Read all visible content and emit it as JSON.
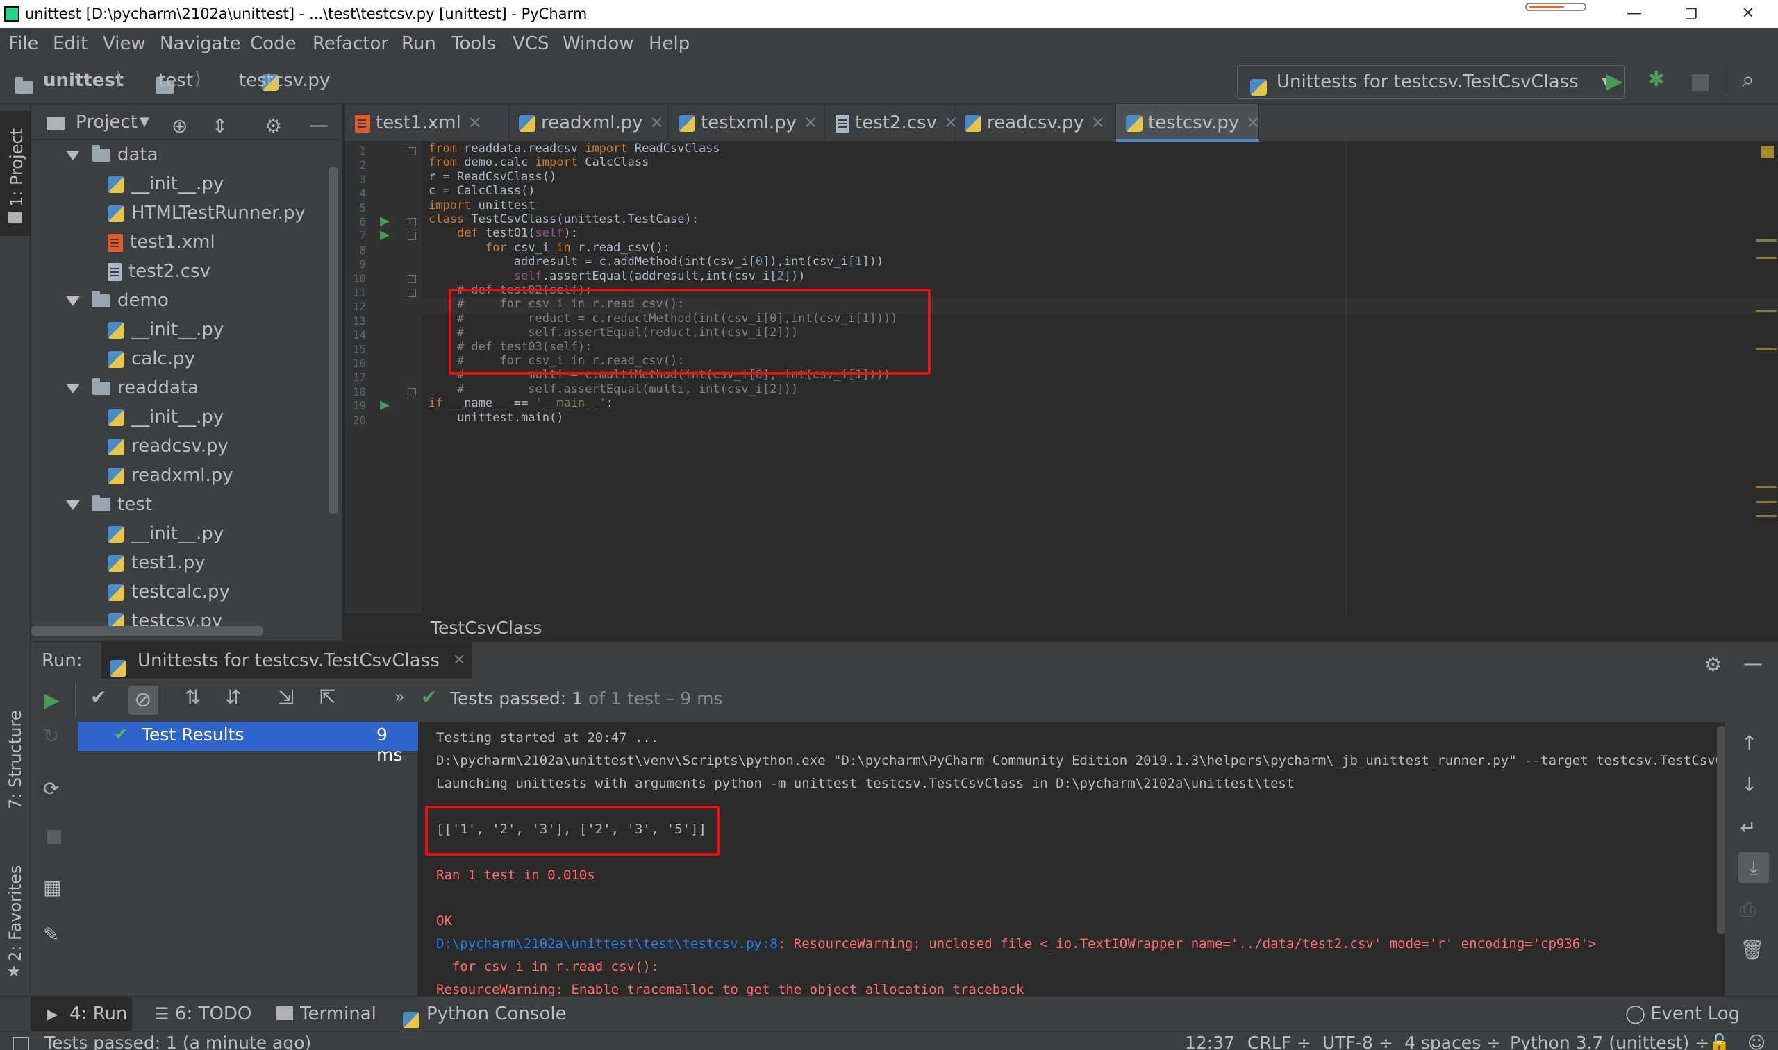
{
  "window": {
    "title": "unittest [D:\\pycharm\\2102a\\unittest] - ...\\test\\testcsv.py [unittest] - PyCharm"
  },
  "menu": [
    "File",
    "Edit",
    "View",
    "Navigate",
    "Code",
    "Refactor",
    "Run",
    "Tools",
    "VCS",
    "Window",
    "Help"
  ],
  "breadcrumb_nav": {
    "root": "unittest",
    "folder": "test",
    "file": "testcsv.py"
  },
  "run_config": {
    "label": "Unittests for testcsv.TestCsvClass"
  },
  "project_panel": {
    "title": "Project",
    "side_label": "1: Project",
    "tree": [
      {
        "label": "data",
        "type": "folder"
      },
      {
        "label": "__init__.py",
        "type": "py"
      },
      {
        "label": "HTMLTestRunner.py",
        "type": "py"
      },
      {
        "label": "test1.xml",
        "type": "xml"
      },
      {
        "label": "test2.csv",
        "type": "csv"
      },
      {
        "label": "demo",
        "type": "folder"
      },
      {
        "label": "__init__.py",
        "type": "py"
      },
      {
        "label": "calc.py",
        "type": "py"
      },
      {
        "label": "readdata",
        "type": "folder"
      },
      {
        "label": "__init__.py",
        "type": "py"
      },
      {
        "label": "readcsv.py",
        "type": "py"
      },
      {
        "label": "readxml.py",
        "type": "py"
      },
      {
        "label": "test",
        "type": "folder"
      },
      {
        "label": "__init__.py",
        "type": "py"
      },
      {
        "label": "test1.py",
        "type": "py"
      },
      {
        "label": "testcalc.py",
        "type": "py"
      },
      {
        "label": "testcsv.py",
        "type": "py"
      }
    ]
  },
  "tabs": [
    {
      "label": "test1.xml",
      "type": "xml"
    },
    {
      "label": "readxml.py",
      "type": "py"
    },
    {
      "label": "testxml.py",
      "type": "py"
    },
    {
      "label": "test2.csv",
      "type": "csv"
    },
    {
      "label": "readcsv.py",
      "type": "py"
    },
    {
      "label": "testcsv.py",
      "type": "py",
      "active": true
    }
  ],
  "editor": {
    "lines": [
      "from readdata.readcsv import ReadCsvClass",
      "from demo.calc import CalcClass",
      "r = ReadCsvClass()",
      "c = CalcClass()",
      "import unittest",
      "class TestCsvClass(unittest.TestCase):",
      "    def test01(self):",
      "        for csv_i in r.read_csv():",
      "            addresult = c.addMethod(int(csv_i[0]),int(csv_i[1]))",
      "            self.assertEqual(addresult,int(csv_i[2]))",
      "    # def test02(self):",
      "    #     for csv_i in r.read_csv():",
      "    #         reduct = c.reductMethod(int(csv_i[0],int(csv_i[1])))",
      "    #         self.assertEqual(reduct,int(csv_i[2]))",
      "    # def test03(self):",
      "    #     for csv_i in r.read_csv():",
      "    #         multi = c.multiMethod(int(csv_i[0], int(csv_i[1])))",
      "    #         self.assertEqual(multi, int(csv_i[2]))",
      "if __name__ == '__main__':",
      "    unittest.main()"
    ],
    "line_numbers": [
      "1",
      "2",
      "3",
      "4",
      "5",
      "6",
      "7",
      "8",
      "9",
      "10",
      "11",
      "12",
      "13",
      "14",
      "15",
      "16",
      "17",
      "18",
      "19",
      "20"
    ],
    "breadcrumb": "TestCsvClass"
  },
  "run_panel": {
    "label": "Run:",
    "tab": "Unittests for testcsv.TestCsvClass",
    "status_prefix": "Tests passed:",
    "status_count": "1",
    "status_suffix": "of 1 test",
    "status_time": "– 9 ms",
    "tree_root": "Test Results",
    "tree_time": "9 ms",
    "console": [
      "Testing started at 20:47 ...",
      "D:\\pycharm\\2102a\\unittest\\venv\\Scripts\\python.exe \"D:\\pycharm\\PyCharm Community Edition 2019.1.3\\helpers\\pycharm\\_jb_unittest_runner.py\" --target testcsv.TestCsvClass",
      "Launching unittests with arguments python -m unittest testcsv.TestCsvClass in D:\\pycharm\\2102a\\unittest\\test",
      "[['1', '2', '3'], ['2', '3', '5']]",
      "Ran 1 test in 0.010s",
      "OK",
      "D:\\pycharm\\2102a\\unittest\\test\\testcsv.py:8",
      ": ResourceWarning: unclosed file <_io.TextIOWrapper name='../data/test2.csv' mode='r' encoding='cp936'>",
      "  for csv_i in r.read_csv():",
      "ResourceWarning: Enable tracemalloc to get the object allocation traceback"
    ]
  },
  "side_labels": {
    "structure": "7: Structure",
    "favorites": "2: Favorites"
  },
  "bottom_tools": {
    "run": "4: Run",
    "todo": "6: TODO",
    "terminal": "Terminal",
    "python_console": "Python Console",
    "event_log": "Event Log"
  },
  "status_bar": {
    "message": "Tests passed: 1 (a minute ago)",
    "position": "12:37",
    "line_sep": "CRLF ÷",
    "encoding": "UTF-8 ÷",
    "indent": "4 spaces ÷",
    "interpreter": "Python 3.7 (unittest) ÷"
  },
  "colors": {
    "accent": "#4a88c7",
    "run_green": "#499c54",
    "highlight_red": "#e81010",
    "selection_blue": "#2f65ca"
  }
}
